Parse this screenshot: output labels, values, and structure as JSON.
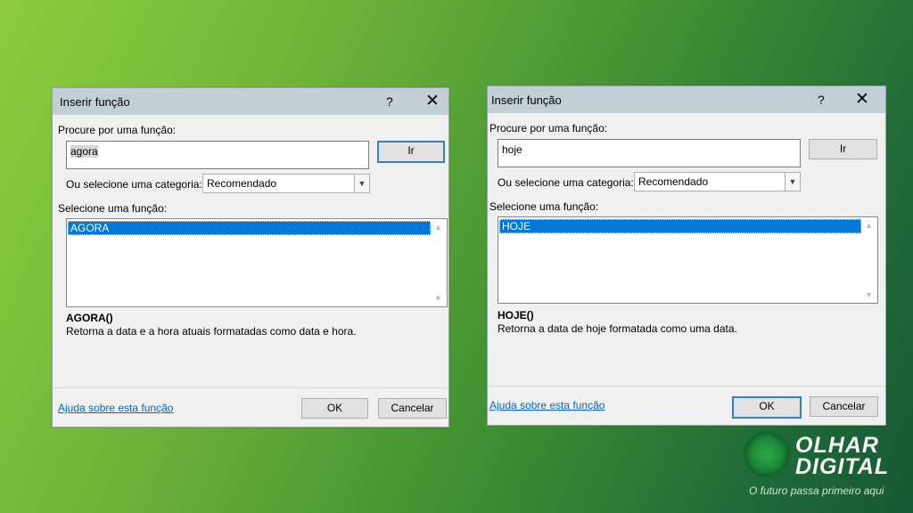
{
  "dialog1": {
    "title": "Inserir função",
    "help": "?",
    "close": "✕",
    "search_label": "Procure por uma função:",
    "search_value": "agora",
    "go": "Ir",
    "category_label": "Ou selecione uma categoria:",
    "category_value": "Recomendado",
    "list_label": "Selecione uma função:",
    "list_items": [
      "AGORA"
    ],
    "signature": "AGORA()",
    "description": "Retorna a data e a hora atuais formatadas como data e hora.",
    "help_link": "Ajuda sobre esta função",
    "ok": "OK",
    "cancel": "Cancelar"
  },
  "dialog2": {
    "title": "Inserir função",
    "help": "?",
    "close": "✕",
    "search_label": "Procure por uma função:",
    "search_value": "hoje",
    "go": "Ir",
    "category_label": "Ou selecione uma categoria:",
    "category_value": "Recomendado",
    "list_label": "Selecione uma função:",
    "list_items": [
      "HOJE"
    ],
    "signature": "HOJE()",
    "description": "Retorna a data de hoje formatada como uma data.",
    "help_link": "Ajuda sobre esta função",
    "ok": "OK",
    "cancel": "Cancelar"
  },
  "logo": {
    "line1": "OLHAR",
    "line2": "DIGITAL",
    "tagline": "O futuro passa primeiro aqui"
  }
}
